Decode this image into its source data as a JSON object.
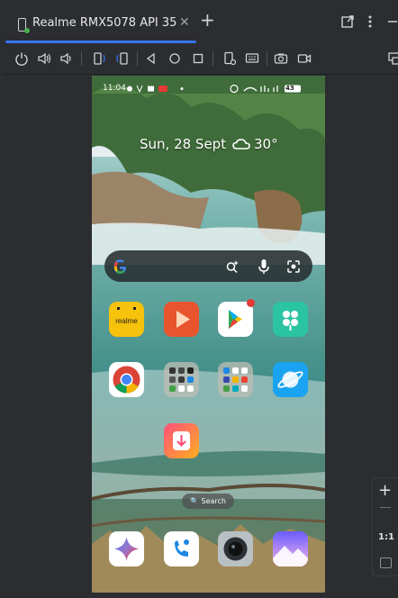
{
  "tab": {
    "title": "Realme RMX5078 API 35"
  },
  "phone": {
    "status_time": "11:04",
    "battery": "43",
    "date": "Sun, 28 Sept",
    "temperature": "30°",
    "dock_search_label": "Search"
  },
  "side_panel": {
    "ratio_label": "1:1"
  },
  "colors": {
    "accent": "#3574f0",
    "status_dot": "#4caf50"
  }
}
